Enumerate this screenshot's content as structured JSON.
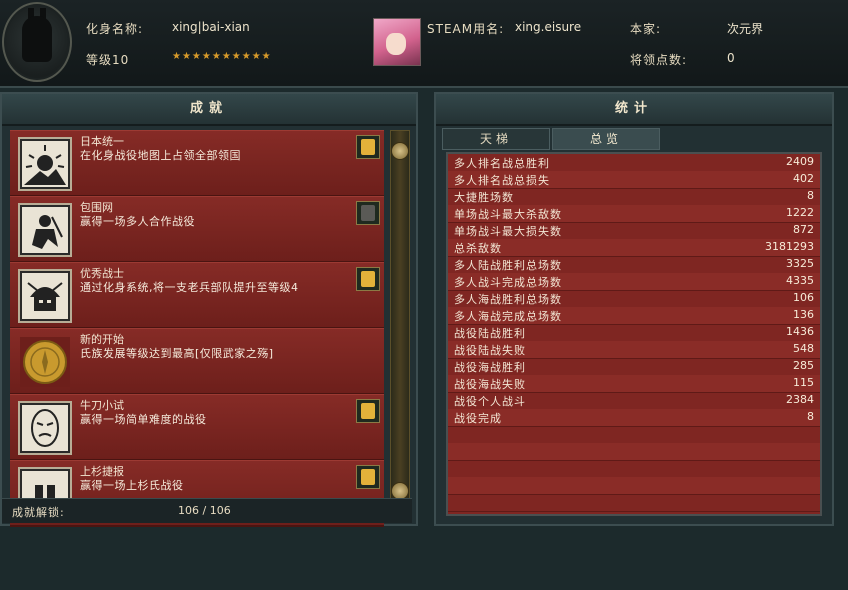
{
  "profile": {
    "avatar_name_label": "化身名称:",
    "avatar_name": "xing|bai-xian",
    "level": "等级10",
    "steam_name_label": "STEAM用名:",
    "steam_name": "xing.eisure",
    "home_label": "本家:",
    "home_value": "次元界",
    "points_label": "将领点数:",
    "points_value": "0",
    "stars": "★★★★★★★★★★"
  },
  "achievements": {
    "title": "成就",
    "items": [
      {
        "title": "日本统一",
        "desc": "在化身战役地图上占领全部领国",
        "icon": "rising-sun-icon",
        "locked": false
      },
      {
        "title": "包围网",
        "desc": "赢得一场多人合作战役",
        "icon": "ninja-icon",
        "locked": true
      },
      {
        "title": "优秀战士",
        "desc": "通过化身系统,将一支老兵部队提升至等级4",
        "icon": "samurai-helmet-icon",
        "locked": false
      },
      {
        "title": "新的开始",
        "desc": "氏族发展等级达到最高[仅限武家之殇]",
        "icon": "gold-coin-icon",
        "locked": false
      },
      {
        "title": "牛刀小试",
        "desc": "赢得一场简单难度的战役",
        "icon": "noh-mask-icon",
        "locked": false
      },
      {
        "title": "上杉捷报",
        "desc": "赢得一场上杉氏战役",
        "icon": "clan-crest-icon",
        "locked": false
      }
    ],
    "unlock_label": "成就解锁:",
    "unlock_count": "106 / 106"
  },
  "stats": {
    "title": "统计",
    "tabs": [
      {
        "label": "天梯",
        "active": false
      },
      {
        "label": "总览",
        "active": true
      }
    ],
    "rows": [
      {
        "label": "多人排名战总胜利",
        "value": "2409"
      },
      {
        "label": "多人排名战总损失",
        "value": "402"
      },
      {
        "label": "大捷胜场数",
        "value": "8"
      },
      {
        "label": "单场战斗最大杀敌数",
        "value": "1222"
      },
      {
        "label": "单场战斗最大损失数",
        "value": "872"
      },
      {
        "label": "总杀敌数",
        "value": "3181293"
      },
      {
        "label": "多人陆战胜利总场数",
        "value": "3325"
      },
      {
        "label": "多人战斗完成总场数",
        "value": "4335"
      },
      {
        "label": "多人海战胜利总场数",
        "value": "106"
      },
      {
        "label": "多人海战完成总场数",
        "value": "136"
      },
      {
        "label": "战役陆战胜利",
        "value": "1436"
      },
      {
        "label": "战役陆战失败",
        "value": "548"
      },
      {
        "label": "战役海战胜利",
        "value": "285"
      },
      {
        "label": "战役海战失败",
        "value": "115"
      },
      {
        "label": "战役个人战斗",
        "value": "2384"
      },
      {
        "label": "战役完成",
        "value": "8"
      }
    ]
  },
  "colors": {
    "accent_red": "#7f2622",
    "gold": "#e3b23a",
    "panel": "#223033"
  }
}
